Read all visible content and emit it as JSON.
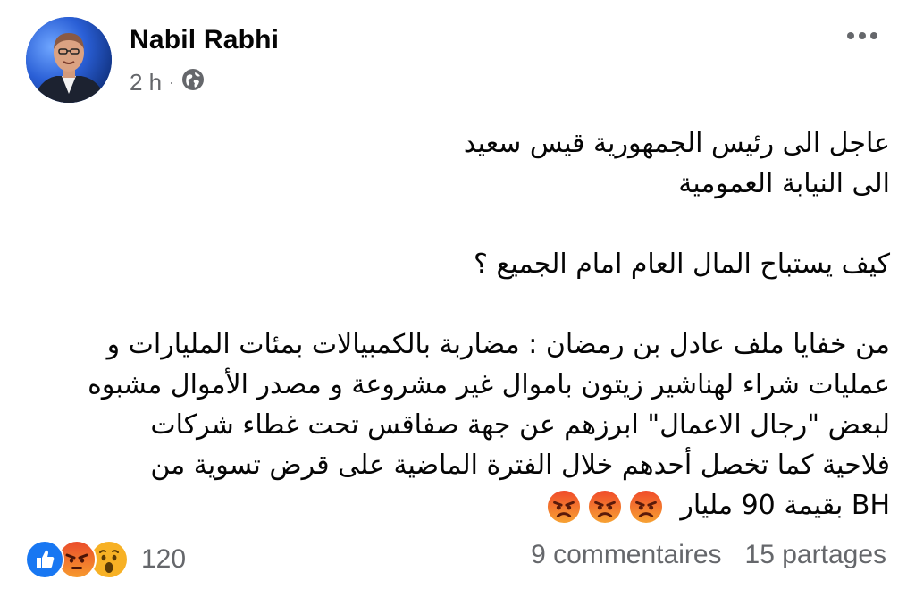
{
  "post": {
    "author": "Nabil Rabhi",
    "time": "2 h",
    "separator": "·",
    "privacy_icon": "globe-icon",
    "more_icon": "more-options-icon",
    "lines": [
      "عاجل الى رئيس الجمهورية قيس سعيد",
      "الى النيابة العمومية",
      "",
      "كيف يستباح المال العام امام الجميع ؟",
      "",
      "من خفايا ملف عادل بن رمضان : مضاربة بالكمبيالات بمئات المليارات و",
      "عمليات شراء لهناشير زيتون باموال غير مشروعة و مصدر الأموال مشبوه",
      "لبعض \"رجال الاعمال\" ابرزهم عن جهة صفاقس تحت غطاء شركات",
      "فلاحية كما تخصل أحدهم خلال الفترة الماضية على قرض تسوية من"
    ],
    "last_line": "BH بقيمة 90 مليار",
    "emojis": [
      "angry-emoji",
      "angry-emoji",
      "angry-emoji"
    ]
  },
  "footer": {
    "reaction_icons": [
      "like-icon",
      "angry-icon",
      "wow-icon"
    ],
    "reaction_count": "120",
    "comments": "9 commentaires",
    "shares": "15 partages"
  },
  "colors": {
    "like": "#1877f2",
    "angry_top": "#f79a2e",
    "angry_bottom": "#ea4c2b",
    "wow": "#f7b125",
    "secondary_text": "#65676b"
  }
}
